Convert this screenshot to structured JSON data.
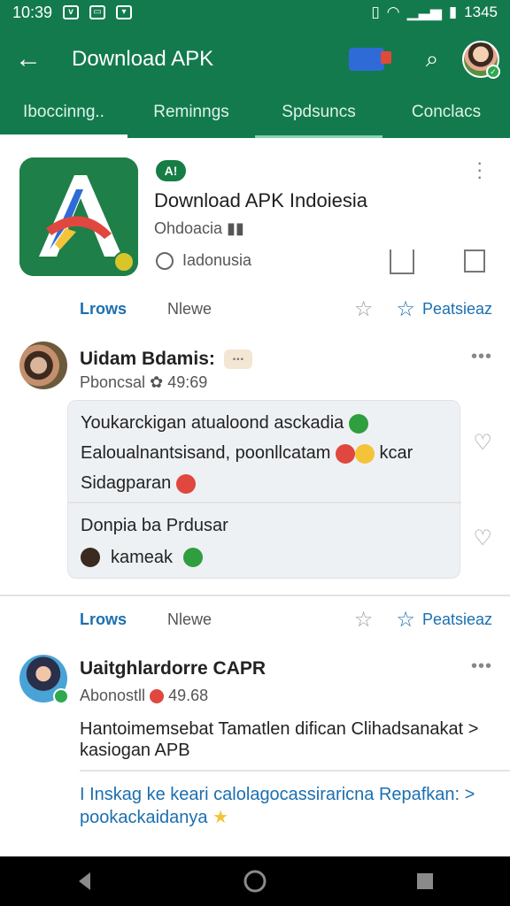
{
  "status_bar": {
    "time": "10:39",
    "battery_text": "1345"
  },
  "app_bar": {
    "title": "Download APK"
  },
  "tabs": [
    {
      "label": "Iboccinng.."
    },
    {
      "label": "Reminngs"
    },
    {
      "label": "Spdsuncs"
    },
    {
      "label": "Conclacs"
    }
  ],
  "app_header": {
    "badge": "A!",
    "title": "Download APK Indoiesia",
    "subtitle": "Ohdoacia",
    "lang": "Iadonusia"
  },
  "action_row": {
    "left_label": "Lrows",
    "mid_label": "Nlewe",
    "right_label": "Peatsieaz"
  },
  "post1": {
    "name": "Uidam Bdamis:",
    "chip": "...",
    "meta_user": "Pboncsal",
    "meta_time": "49:69",
    "quote_lines": [
      "Youkarckigan atualoond asckadia",
      "Ealoualnantsisand, poonllcatam",
      "Sidagparan"
    ],
    "quote_tail_word": "kcar",
    "reply_title": "Donpia ba Prdusar",
    "reply_user": "kameak"
  },
  "post2": {
    "name": "Uaitghlardorre CAPR",
    "meta_user": "Abonostll",
    "meta_time": "49.68",
    "body_lines": [
      "Hantoimemsebat Tamatlen difican Clihadsanakat >",
      "kasiogan APB"
    ],
    "link_lines": [
      "I Inskag ke keari calolagocassiraricna Repafkan: >",
      "pookackaidanya"
    ]
  },
  "colors": {
    "brand_green": "#137a4e",
    "link_blue": "#1b6fb0"
  }
}
